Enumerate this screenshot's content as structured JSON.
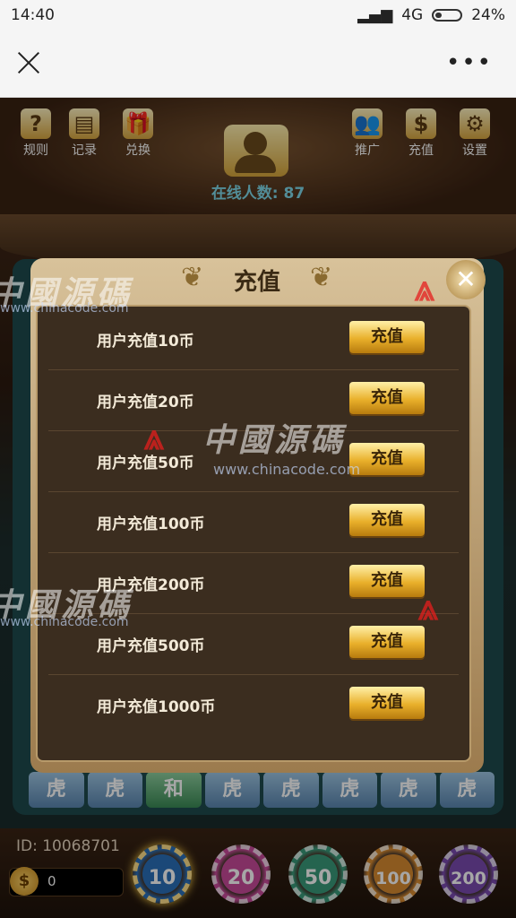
{
  "status_bar": {
    "time": "14:40",
    "network": "4G",
    "battery": "24%"
  },
  "nav": {
    "more": "•••"
  },
  "game": {
    "top_buttons": [
      {
        "label": "规则",
        "icon": "?"
      },
      {
        "label": "记录",
        "icon": "▤"
      },
      {
        "label": "兑换",
        "icon": "🎁"
      }
    ],
    "right_buttons": [
      {
        "label": "推广",
        "icon": "👥"
      },
      {
        "label": "充值",
        "icon": "$"
      },
      {
        "label": "设置",
        "icon": "⚙"
      }
    ],
    "online": "在线人数: 87",
    "tiles": [
      "虎",
      "虎",
      "和",
      "虎",
      "虎",
      "虎",
      "虎",
      "虎"
    ],
    "user_id": "ID: 10068701",
    "balance": "0",
    "chips": [
      "10",
      "20",
      "50",
      "100",
      "200"
    ],
    "chip_colors": [
      "#2a6fb8",
      "#c84a9a",
      "#3a9a7a",
      "#d88a30",
      "#7a4ab0"
    ]
  },
  "dialog": {
    "title": "充值",
    "close": "✕",
    "button_label": "充值",
    "items": [
      {
        "label": "用户充值10币"
      },
      {
        "label": "用户充值20币"
      },
      {
        "label": "用户充值50币"
      },
      {
        "label": "用户充值100币"
      },
      {
        "label": "用户充值200币"
      },
      {
        "label": "用户充值500币"
      },
      {
        "label": "用户充值1000币"
      }
    ]
  },
  "watermark": {
    "text": "中國源碼",
    "url": "www.chinacode.com"
  }
}
